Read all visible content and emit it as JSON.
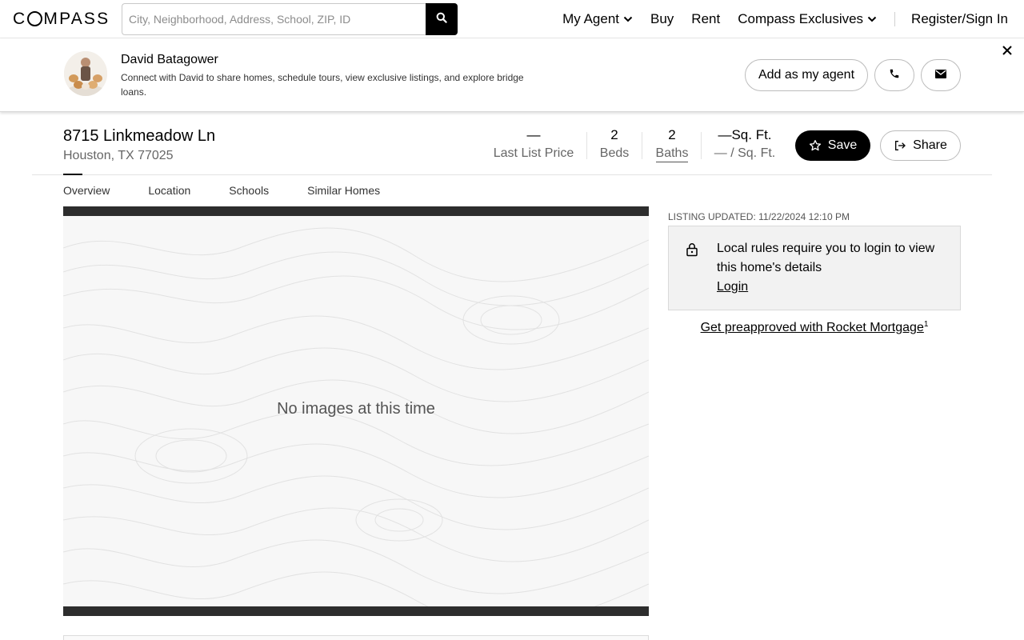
{
  "brand": {
    "logo": "COMPASS"
  },
  "search": {
    "placeholder": "City, Neighborhood, Address, School, ZIP, ID",
    "icon": "search-icon"
  },
  "nav": {
    "my_agent": "My Agent",
    "buy": "Buy",
    "rent": "Rent",
    "exclusives": "Compass Exclusives",
    "register": "Register/Sign In"
  },
  "agent": {
    "name": "David Batagower",
    "description": "Connect with David to share homes, schedule tours, view exclusive listings, and explore bridge loans.",
    "add_label": "Add as my agent"
  },
  "listing": {
    "street": "8715 Linkmeadow Ln",
    "city": "Houston, TX 77025",
    "price_value": "—",
    "price_label": "Last List Price",
    "beds_value": "2",
    "beds_label": "Beds",
    "baths_value": "2",
    "baths_label": "Baths",
    "sqft_value": "—Sq. Ft.",
    "sqft_label": "— / Sq. Ft.",
    "save_label": "Save",
    "share_label": "Share"
  },
  "tabs": [
    {
      "label": "Overview",
      "active": true
    },
    {
      "label": "Location"
    },
    {
      "label": "Schools"
    },
    {
      "label": "Similar Homes"
    }
  ],
  "gallery": {
    "message": "No images at this time"
  },
  "sidebar": {
    "updated": "LISTING UPDATED: 11/22/2024 12:10 PM",
    "login_message": "Local rules require you to login to view this home's details",
    "login_link": "Login",
    "mortgage_link": "Get preapproved with Rocket Mortgage",
    "mortgage_footnote": "1"
  },
  "colors": {
    "primary": "#000000",
    "muted": "#666666",
    "panel": "#f2f2f2",
    "gallery_frame": "#2d2d2d"
  }
}
